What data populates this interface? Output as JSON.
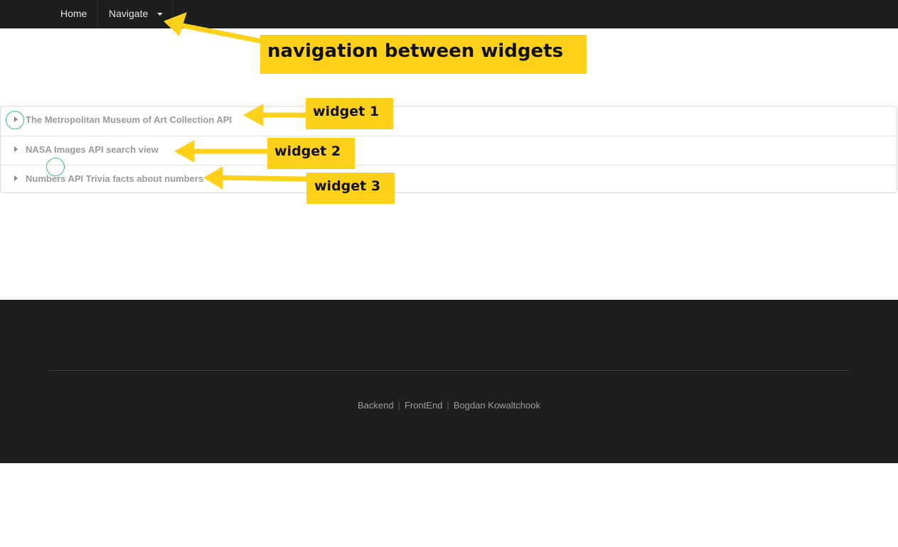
{
  "nav": {
    "home_label": "Home",
    "navigate_label": "Navigate"
  },
  "accordion": {
    "items": [
      {
        "title": "The Metropolitan Museum of Art Collection API"
      },
      {
        "title": "NASA Images API search view"
      },
      {
        "title": "Numbers API Trivia facts about numbers"
      }
    ]
  },
  "footer": {
    "links": [
      "Backend",
      "FrontEnd",
      "Bogdan Kowaltchook"
    ]
  },
  "annotations": {
    "nav_note": "navigation between widgets",
    "widget1": "widget 1",
    "widget2": "widget 2",
    "widget3": "widget 3"
  },
  "colors": {
    "nav_bg": "#1d1e20",
    "callout": "#fdd11a",
    "highlight_ring": "#3cc36a"
  }
}
